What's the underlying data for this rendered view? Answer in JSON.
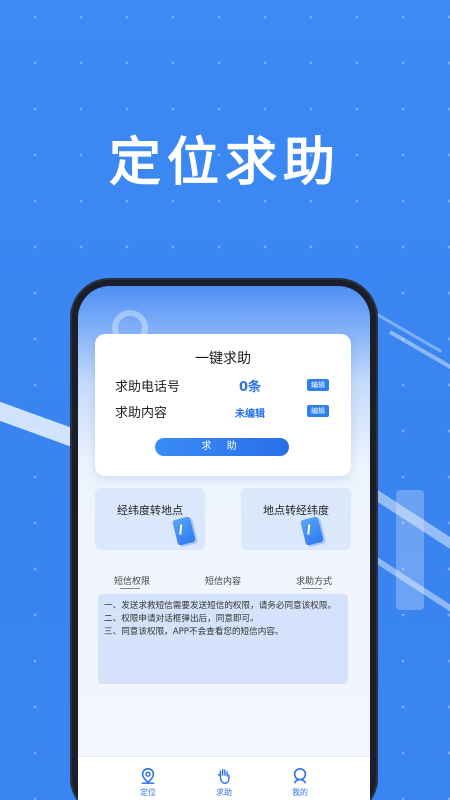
{
  "hero": {
    "title": "定位求助"
  },
  "card": {
    "title": "一键求助",
    "phone_label": "求助电话号",
    "phone_count": "0条",
    "content_label": "求助内容",
    "content_value": "未编辑",
    "edit_label": "编辑",
    "sos_label": "求 助"
  },
  "convert": {
    "latlng_to_place": "经纬度转地点",
    "place_to_latlng": "地点转经纬度"
  },
  "tabs": [
    {
      "label": "短信权限"
    },
    {
      "label": "短信内容"
    },
    {
      "label": "求助方式"
    }
  ],
  "notice": {
    "line1": "一、发送求救短信需要发送短信的权限，请务必同意该权限。",
    "line2": "二、权限申请对话框弹出后，同意即可。",
    "line3": "三、同意该权限，APP不会查看您的短信内容。"
  },
  "nav": [
    {
      "label": "定位",
      "icon": "location-pin-icon"
    },
    {
      "label": "求助",
      "icon": "hand-icon"
    },
    {
      "label": "我的",
      "icon": "user-icon"
    }
  ],
  "colors": {
    "accent": "#2c73ea",
    "background": "#3b86f2",
    "panel": "#d4e3fb"
  }
}
